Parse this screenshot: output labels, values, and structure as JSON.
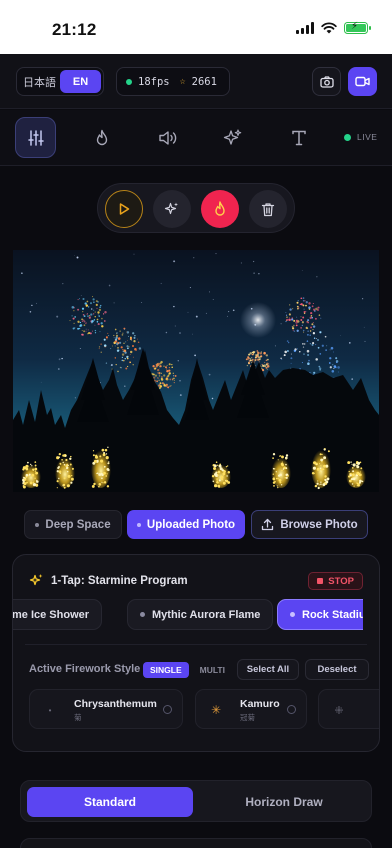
{
  "status": {
    "time": "21:12"
  },
  "header": {
    "lang_ja": "日本語",
    "lang_en": "EN",
    "fps": "18fps",
    "count": "2661"
  },
  "toolbar": {
    "items": [
      "sliders-icon",
      "flame-icon",
      "sound-icon",
      "sparkles-icon",
      "text-icon"
    ],
    "live_label": "LIVE"
  },
  "controls": [
    "play-icon",
    "sparkle-icon",
    "fire-icon",
    "trash-icon"
  ],
  "sources": {
    "deep_space": "Deep Space",
    "uploaded": "Uploaded Photo",
    "browse": "Browse Photo"
  },
  "program": {
    "title": "1-Tap: Starmine Program",
    "stop_label": "STOP",
    "chips": [
      "me Ice Shower",
      "Mythic Aurora Flame",
      "Rock Stadiu"
    ],
    "active_chip": 2
  },
  "styles": {
    "label": "Active Firework Style",
    "single": "SINGLE",
    "multi": "MULTI",
    "select_all": "Select All",
    "deselect": "Deselect",
    "items": [
      {
        "name": "Chrysanthemum",
        "sub": "菊"
      },
      {
        "name": "Kamuro",
        "sub": "冠菊"
      }
    ]
  },
  "tabs": {
    "standard": "Standard",
    "horizon": "Horizon Draw"
  },
  "colors": {
    "accent": "#5b45f2",
    "fire": "#f0244f",
    "live": "#24d38a",
    "stop": "#f25468"
  }
}
